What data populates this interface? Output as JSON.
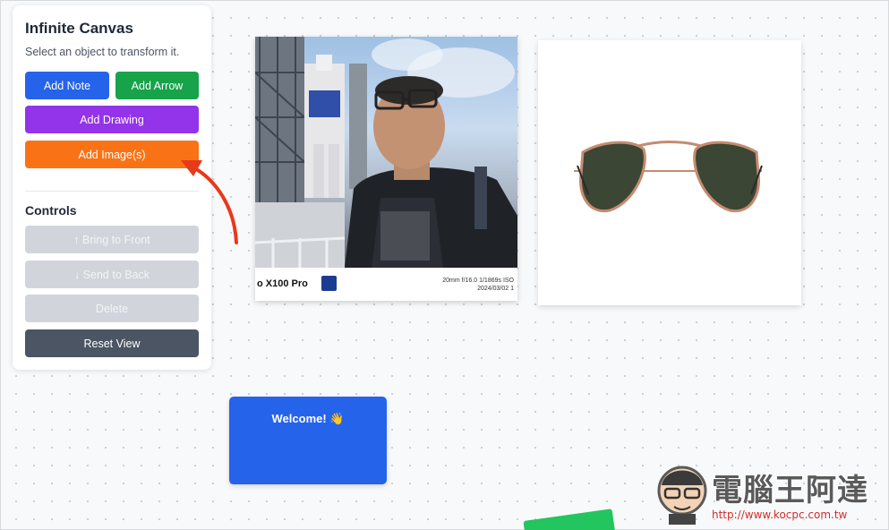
{
  "panel": {
    "title": "Infinite Canvas",
    "subtitle": "Select an object to transform it.",
    "buttons": {
      "add_note": "Add Note",
      "add_arrow": "Add Arrow",
      "add_drawing": "Add Drawing",
      "add_images": "Add Image(s)"
    },
    "controls_title": "Controls",
    "controls": {
      "bring_front": "↑ Bring to Front",
      "send_back": "↓ Send to Back",
      "delete": "Delete",
      "reset_view": "Reset View"
    },
    "colors": {
      "add_note": "#2563eb",
      "add_arrow": "#16a34a",
      "add_drawing": "#9333ea",
      "add_images": "#f97316",
      "disabled": "#d1d5db",
      "reset": "#4b5563"
    }
  },
  "canvas": {
    "photo": {
      "footer_brand": "o X100 Pro",
      "footer_meta_line1": "20mm  f/16.0  1/1869s  ISO",
      "footer_meta_line2": "2024/03/02 1"
    },
    "note": {
      "text": "Welcome! 👋"
    }
  },
  "watermark": {
    "title": "電腦王阿達",
    "url": "http://www.kocpc.com.tw"
  }
}
